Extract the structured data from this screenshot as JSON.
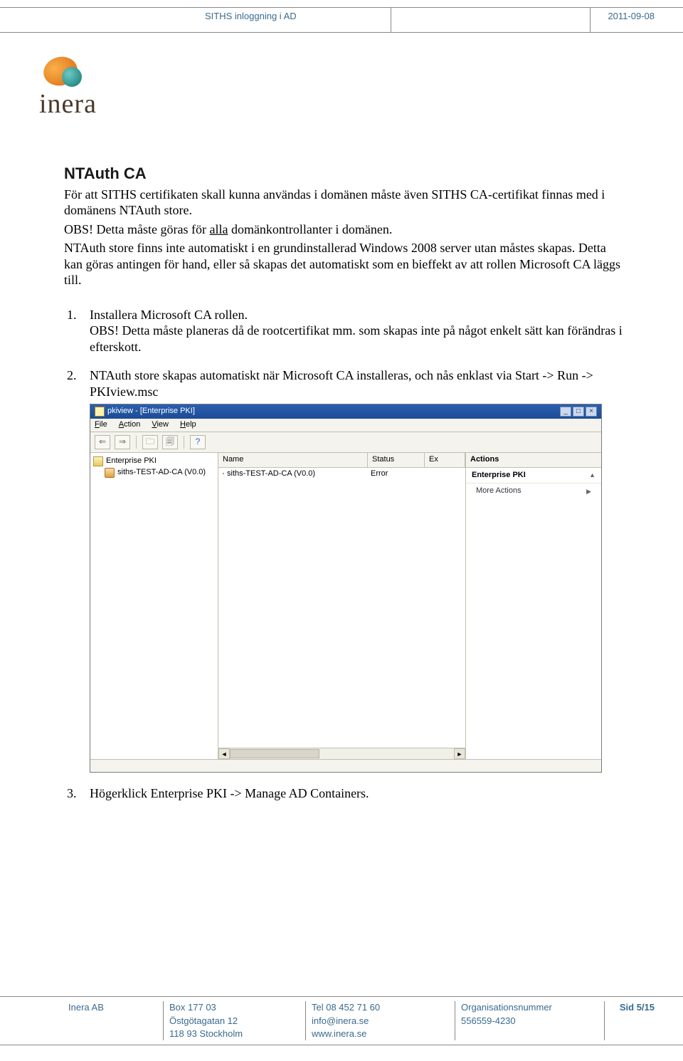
{
  "header": {
    "doc_title": "SITHS inloggning i AD",
    "date": "2011-09-08"
  },
  "logo": {
    "text": "inera"
  },
  "body": {
    "heading": "NTAuth CA",
    "p1a": "För att SITHS certifikaten skall kunna användas i domänen måste även SITHS CA-certifikat finnas med i domänens NTAuth store.",
    "p2_prefix": "OBS! Detta måste göras för ",
    "p2_underline": "alla",
    "p2_suffix": " domänkontrollanter i domänen.",
    "p3": "NTAuth store finns inte automatiskt i en grundinstallerad Windows 2008 server utan måstes skapas. Detta kan göras antingen för hand, eller så skapas det automatiskt som en bieffekt av att rollen Microsoft CA läggs till.",
    "item1_num": "1.",
    "item1_a": "Installera Microsoft CA rollen.",
    "item1_b": "OBS! Detta måste planeras då de rootcertifikat mm. som skapas inte på något enkelt sätt kan förändras i efterskott.",
    "item2_num": "2.",
    "item2": "NTAuth store skapas automatiskt när Microsoft CA installeras, och nås enklast via Start -> Run -> PKIview.msc",
    "item3_num": "3.",
    "item3": "Högerklick Enterprise PKI -> Manage AD Containers."
  },
  "screenshot": {
    "title": "pkiview - [Enterprise PKI]",
    "menu": {
      "file": "File",
      "action": "Action",
      "view": "View",
      "help": "Help"
    },
    "tree": {
      "root": "Enterprise PKI",
      "child": "siths-TEST-AD-CA (V0.0)"
    },
    "list": {
      "col_name": "Name",
      "col_status": "Status",
      "col_ex": "Ex",
      "row_name": "siths-TEST-AD-CA (V0.0)",
      "row_status": "Error"
    },
    "actions": {
      "header": "Actions",
      "sub": "Enterprise PKI",
      "more": "More Actions"
    }
  },
  "footer": {
    "company": "Inera AB",
    "addr1": "Box 177 03",
    "addr2": "Östgötagatan 12",
    "addr3": "118 93 Stockholm",
    "tel": "Tel 08 452 71 60",
    "email": "info@inera.se",
    "web": "www.inera.se",
    "orglabel": "Organisationsnummer",
    "orgnum": "556559-4230",
    "page": "Sid 5/15"
  }
}
